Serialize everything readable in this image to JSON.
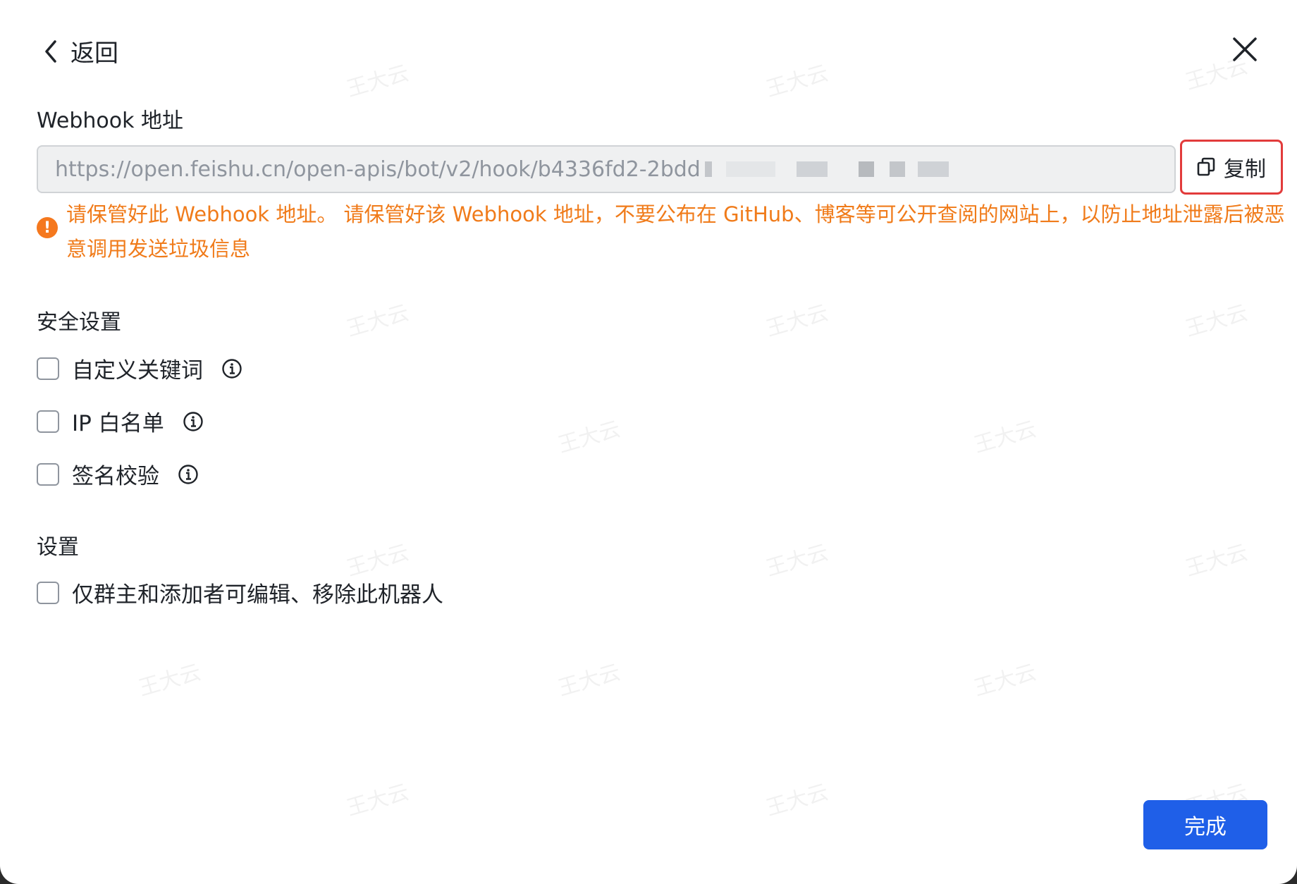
{
  "header": {
    "back_label": "返回"
  },
  "webhook": {
    "title": "Webhook 地址",
    "url": "https://open.feishu.cn/open-apis/bot/v2/hook/b4336fd2-2bdd",
    "copy_label": "复制",
    "warning": "请保管好此 Webhook 地址。 请保管好该 Webhook 地址，不要公布在 GitHub、博客等可公开查阅的网站上，以防止地址泄露后被恶意调用发送垃圾信息"
  },
  "security": {
    "title": "安全设置",
    "options": [
      {
        "label": "自定义关键词"
      },
      {
        "label": "IP 白名单"
      },
      {
        "label": "签名校验"
      }
    ]
  },
  "settings": {
    "title": "设置",
    "options": [
      {
        "label": "仅群主和添加者可编辑、移除此机器人"
      }
    ]
  },
  "footer": {
    "done_label": "完成"
  },
  "watermark": "王大云",
  "colors": {
    "primary": "#1f5fe8",
    "warning": "#f07b1a",
    "highlight": "#e23b3b"
  }
}
